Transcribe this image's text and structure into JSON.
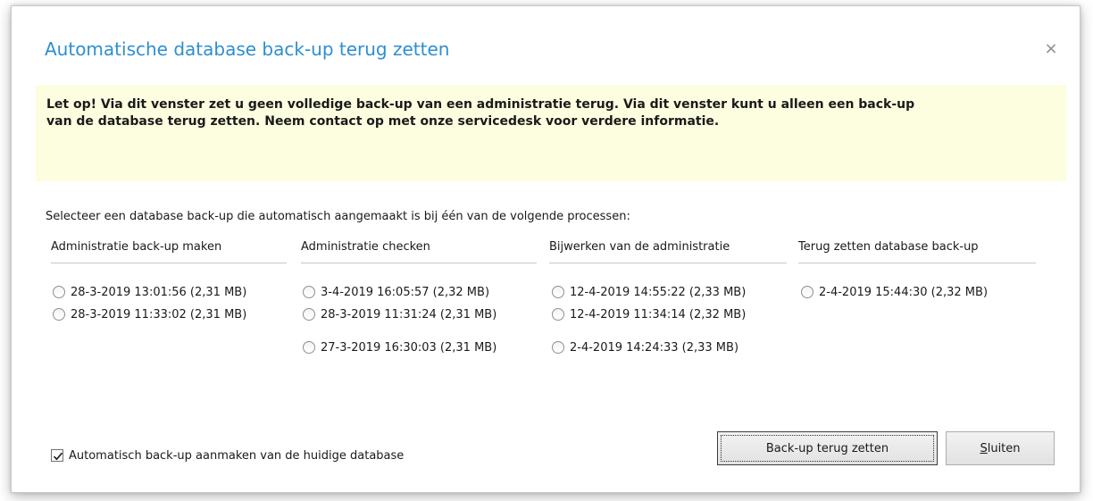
{
  "dialog": {
    "title": "Automatische database back-up terug zetten",
    "close_symbol": "×",
    "warning": "Let op! Via dit venster zet u geen volledige back-up van een administratie terug. Via dit venster kunt u alleen een back-up\nvan de database terug zetten. Neem contact op met onze servicedesk voor verdere informatie.",
    "instruction": "Selecteer een database back-up die automatisch aangemaakt is bij één van de volgende processen:"
  },
  "columns": [
    {
      "header": "Administratie back-up maken",
      "options": [
        "28-3-2019 13:01:56 (2,31 MB)",
        "28-3-2019 11:33:02 (2,31 MB)"
      ]
    },
    {
      "header": "Administratie checken",
      "options": [
        "3-4-2019 16:05:57 (2,32 MB)",
        "28-3-2019 11:31:24 (2,31 MB)",
        "27-3-2019 16:30:03 (2,31 MB)"
      ]
    },
    {
      "header": "Bijwerken van de administratie",
      "options": [
        "12-4-2019 14:55:22 (2,33 MB)",
        "12-4-2019 11:34:14 (2,32 MB)",
        "2-4-2019 14:24:33 (2,33 MB)"
      ]
    },
    {
      "header": "Terug zetten database back-up",
      "options": [
        "2-4-2019 15:44:30 (2,32 MB)"
      ]
    }
  ],
  "footer": {
    "checkbox_label": "Automatisch back-up aanmaken van de huidige database",
    "checkbox_checked": true,
    "restore_button": "Back-up terug zetten",
    "close_button": "Sluiten"
  },
  "colors": {
    "title": "#2e8fcf",
    "warning_background": "#fdfde0"
  },
  "icons": {
    "close": "close-icon",
    "radio": "radio-icon",
    "checkbox": "checkmark-icon"
  }
}
